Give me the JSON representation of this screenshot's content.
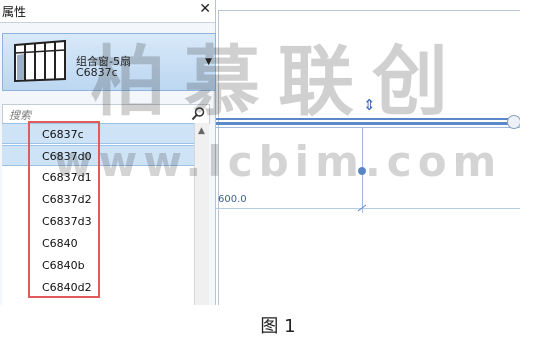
{
  "panel": {
    "title": "属性",
    "close": "✕",
    "type_selector": {
      "family": "组合窗-5扇",
      "type": "C6837c",
      "dropdown": "▼"
    },
    "search": {
      "placeholder": "搜索"
    },
    "types": [
      {
        "label": "C6837c",
        "selected": true
      },
      {
        "label": "C6837d0",
        "selected": true
      },
      {
        "label": "C6837d1",
        "selected": false
      },
      {
        "label": "C6837d2",
        "selected": false
      },
      {
        "label": "C6837d3",
        "selected": false
      },
      {
        "label": "C6840",
        "selected": false
      },
      {
        "label": "C6840b",
        "selected": false
      },
      {
        "label": "C6840d2",
        "selected": false
      }
    ],
    "scroll_up": "▲"
  },
  "canvas": {
    "dimension": "600.0",
    "flip_glyph": "⇕"
  },
  "watermark": {
    "line1": "柏慕联创",
    "line2": "www.lcbim.com"
  },
  "caption": "图 1",
  "colors": {
    "highlight_box": "#e25a5a",
    "selection": "#cfe3f7",
    "wall": "#5a88c8"
  }
}
